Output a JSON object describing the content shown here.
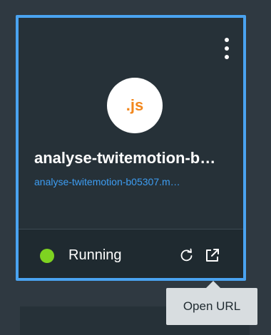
{
  "card": {
    "logo_text": ".js",
    "app_name": "analyse-twitemotion-b…",
    "app_url": "analyse-twitemotion-b05307.m…",
    "status": "Running",
    "colors": {
      "border": "#4aa3f0",
      "status_running": "#7ed321",
      "link": "#3d9df2",
      "logo": "#f2871d"
    }
  },
  "icons": {
    "menu": "kebab-menu-icon",
    "restart": "restart-icon",
    "open_url": "external-link-icon"
  },
  "tooltip": {
    "text": "Open URL"
  }
}
